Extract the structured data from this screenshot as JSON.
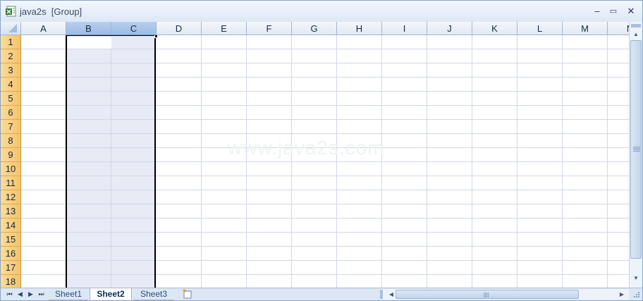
{
  "window": {
    "title": "java2s  [Group]",
    "minimize_glyph": "–",
    "maximize_glyph": "▭",
    "close_glyph": "✕",
    "app_icon": "excel-workbook-icon"
  },
  "grid": {
    "columns": [
      "A",
      "B",
      "C",
      "D",
      "E",
      "F",
      "G",
      "H",
      "I",
      "J",
      "K",
      "L",
      "M",
      "N"
    ],
    "rows": [
      "1",
      "2",
      "3",
      "4",
      "5",
      "6",
      "7",
      "8",
      "9",
      "10",
      "11",
      "12",
      "13",
      "14",
      "15",
      "16",
      "17",
      "18"
    ],
    "selected_columns": [
      "B",
      "C"
    ],
    "active_cell": "B1",
    "watermark": "www.java2s.com"
  },
  "sheet_tabs": {
    "nav_glyphs": [
      "⏮",
      "◀",
      "▶",
      "⏭"
    ],
    "tabs": [
      {
        "label": "Sheet1",
        "active": false
      },
      {
        "label": "Sheet2",
        "active": true
      },
      {
        "label": "Sheet3",
        "active": false
      }
    ],
    "insert_sheet_icon": "insert-worksheet-icon"
  },
  "colors": {
    "row_header": "#f6c36a",
    "selected_column_header": "#9cbbe4",
    "selection_fill": "#e8eaf6",
    "gridline": "#d0d7e5"
  }
}
